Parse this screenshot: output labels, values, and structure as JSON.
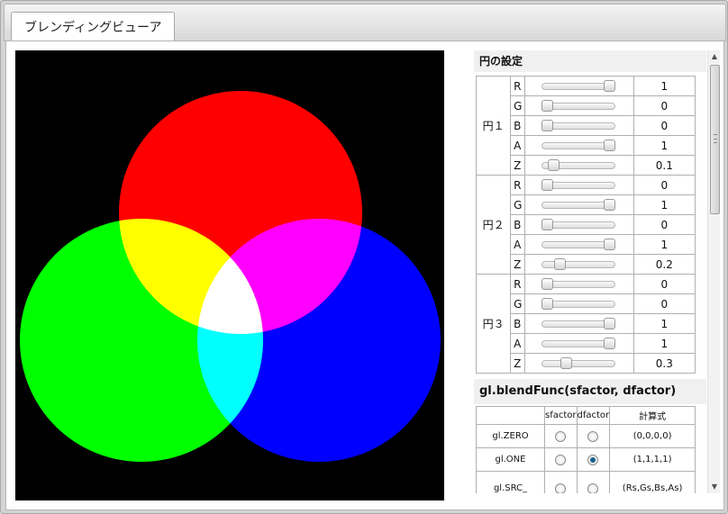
{
  "tab": {
    "label": "ブレンディングビューア"
  },
  "circles_header": "円の設定",
  "circles": [
    {
      "name": "円１",
      "rows": [
        {
          "comp": "R",
          "value": "1",
          "pos": 1
        },
        {
          "comp": "G",
          "value": "0",
          "pos": 0
        },
        {
          "comp": "B",
          "value": "0",
          "pos": 0
        },
        {
          "comp": "A",
          "value": "1",
          "pos": 1
        },
        {
          "comp": "Z",
          "value": "0.1",
          "pos": 0.1
        }
      ]
    },
    {
      "name": "円２",
      "rows": [
        {
          "comp": "R",
          "value": "0",
          "pos": 0
        },
        {
          "comp": "G",
          "value": "1",
          "pos": 1
        },
        {
          "comp": "B",
          "value": "0",
          "pos": 0
        },
        {
          "comp": "A",
          "value": "1",
          "pos": 1
        },
        {
          "comp": "Z",
          "value": "0.2",
          "pos": 0.2
        }
      ]
    },
    {
      "name": "円３",
      "rows": [
        {
          "comp": "R",
          "value": "0",
          "pos": 0
        },
        {
          "comp": "G",
          "value": "0",
          "pos": 0
        },
        {
          "comp": "B",
          "value": "1",
          "pos": 1
        },
        {
          "comp": "A",
          "value": "1",
          "pos": 1
        },
        {
          "comp": "Z",
          "value": "0.3",
          "pos": 0.3
        }
      ]
    }
  ],
  "blend_header": "gl.blendFunc(sfactor, dfactor)",
  "blend_table": {
    "headers": [
      "",
      "sfactor",
      "dfactor",
      "計算式"
    ],
    "rows": [
      {
        "name": "gl.ZERO",
        "s": false,
        "d": false,
        "formula": "(0,0,0,0)"
      },
      {
        "name": "gl.ONE",
        "s": false,
        "d": true,
        "formula": "(1,1,1,1)"
      },
      {
        "name": "gl.SRC_",
        "s": false,
        "d": false,
        "formula": "(Rs,Gs,Bs,As)"
      }
    ]
  },
  "colors": {
    "circle1": "#ff0000",
    "circle2": "#00ff00",
    "circle3": "#0000ff",
    "background": "#000000",
    "radio_selected": "#1a5f8c"
  }
}
